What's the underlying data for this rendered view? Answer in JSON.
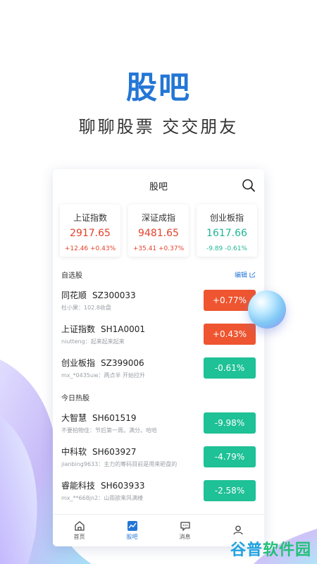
{
  "promo": {
    "headline": "股吧",
    "tagline": "聊聊股票 交交朋友"
  },
  "app": {
    "title": "股吧",
    "indices": [
      {
        "name": "上证指数",
        "value": "2917.65",
        "change": "+12.46 +0.43%",
        "trend": "up"
      },
      {
        "name": "深证成指",
        "value": "9481.65",
        "change": "+35.41 +0.37%",
        "trend": "up"
      },
      {
        "name": "创业板指",
        "value": "1617.66",
        "change": "-9.89 -0.61%",
        "trend": "down"
      }
    ],
    "watchlist": {
      "title": "自选股",
      "edit_label": "编辑",
      "items": [
        {
          "name": "同花顺",
          "code": "SZ300033",
          "note": "杜小果：102.8收盘",
          "pct": "+0.77%",
          "trend": "up"
        },
        {
          "name": "上证指数",
          "code": "SH1A0001",
          "note": "niutteng：起来起来起来",
          "pct": "+0.43%",
          "trend": "up"
        },
        {
          "name": "创业板指",
          "code": "SZ399006",
          "note": "mx_*0435uw：两点半 开始拉升",
          "pct": "-0.61%",
          "trend": "down"
        }
      ]
    },
    "hot": {
      "title": "今日热股",
      "items": [
        {
          "name": "大智慧",
          "code": "SH601519",
          "note": "不要拍物佳：节后第一周。满分。哈哈",
          "pct": "-9.98%",
          "trend": "down"
        },
        {
          "name": "中科软",
          "code": "SH603927",
          "note": "jianbing9633：主力的筹码目前是用来砸盘的",
          "pct": "-4.79%",
          "trend": "down"
        },
        {
          "name": "睿能科技",
          "code": "SH603933",
          "note": "mx_**668jn2：山雨欲来风满楼",
          "pct": "-2.58%",
          "trend": "down"
        }
      ]
    },
    "tabs": [
      {
        "label": "首页",
        "icon": "home-icon"
      },
      {
        "label": "股吧",
        "icon": "chart-icon"
      },
      {
        "label": "消息",
        "icon": "message-icon"
      },
      {
        "label": "",
        "icon": "user-icon"
      }
    ]
  },
  "watermark": {
    "part1": "谷普",
    "part2": "软件园"
  },
  "colors": {
    "accent": "#2376d6",
    "up": "#ee5530",
    "down": "#1fc196"
  }
}
